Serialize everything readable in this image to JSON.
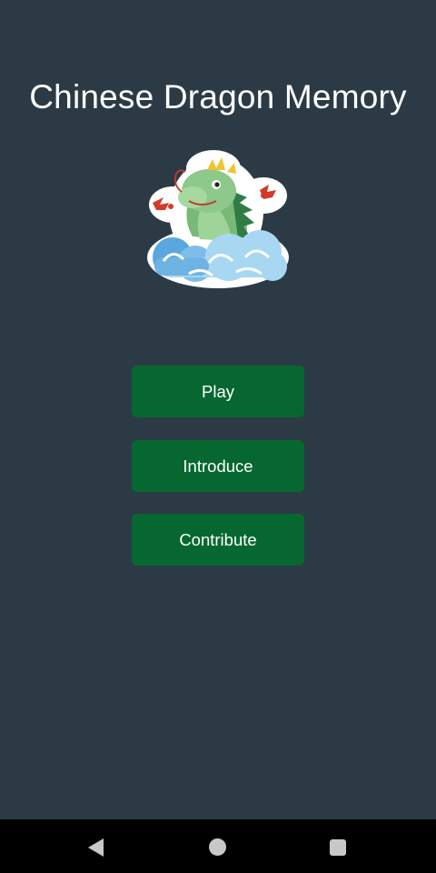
{
  "app": {
    "title": "Chinese Dragon Memory"
  },
  "logo": {
    "icon": "chinese-dragon-on-clouds-icon"
  },
  "menu": {
    "play_label": "Play",
    "introduce_label": "Introduce",
    "contribute_label": "Contribute"
  },
  "navbar": {
    "back_icon": "back-triangle-icon",
    "home_icon": "home-circle-icon",
    "recents_icon": "recents-square-icon"
  },
  "colors": {
    "background": "#2c3a46",
    "button": "#066830",
    "text": "#ffffff",
    "navbar": "#000000"
  }
}
